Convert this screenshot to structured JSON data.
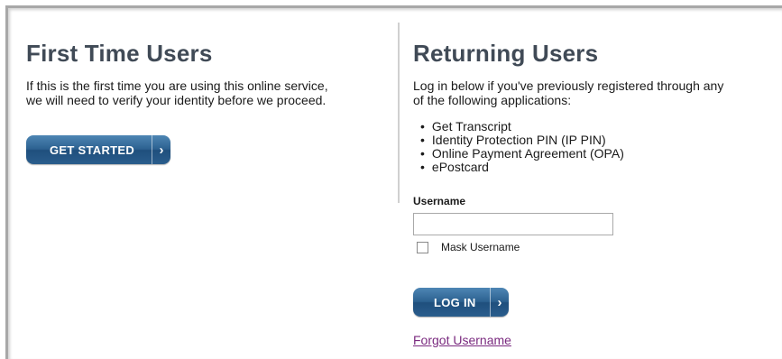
{
  "first_time": {
    "title": "First Time Users",
    "description_line1": "If this is the first time you are using this online service,",
    "description_line2": "we will need to verify your identity before we proceed.",
    "button_label": "GET STARTED",
    "button_icon": "chevron-right-icon"
  },
  "returning": {
    "title": "Returning Users",
    "description_line1": "Log in below if you've previously registered through any",
    "description_line2": "of the following applications:",
    "applications": [
      "Get Transcript",
      "Identity Protection PIN (IP PIN)",
      "Online Payment Agreement (OPA)",
      "ePostcard"
    ],
    "username_label": "Username",
    "username_value": "",
    "mask_label": "Mask Username",
    "mask_checked": false,
    "login_label": "LOG IN",
    "forgot_link": "Forgot Username"
  },
  "colors": {
    "heading": "#404a56",
    "button": "#2c6190",
    "link": "#7a2a7f"
  }
}
